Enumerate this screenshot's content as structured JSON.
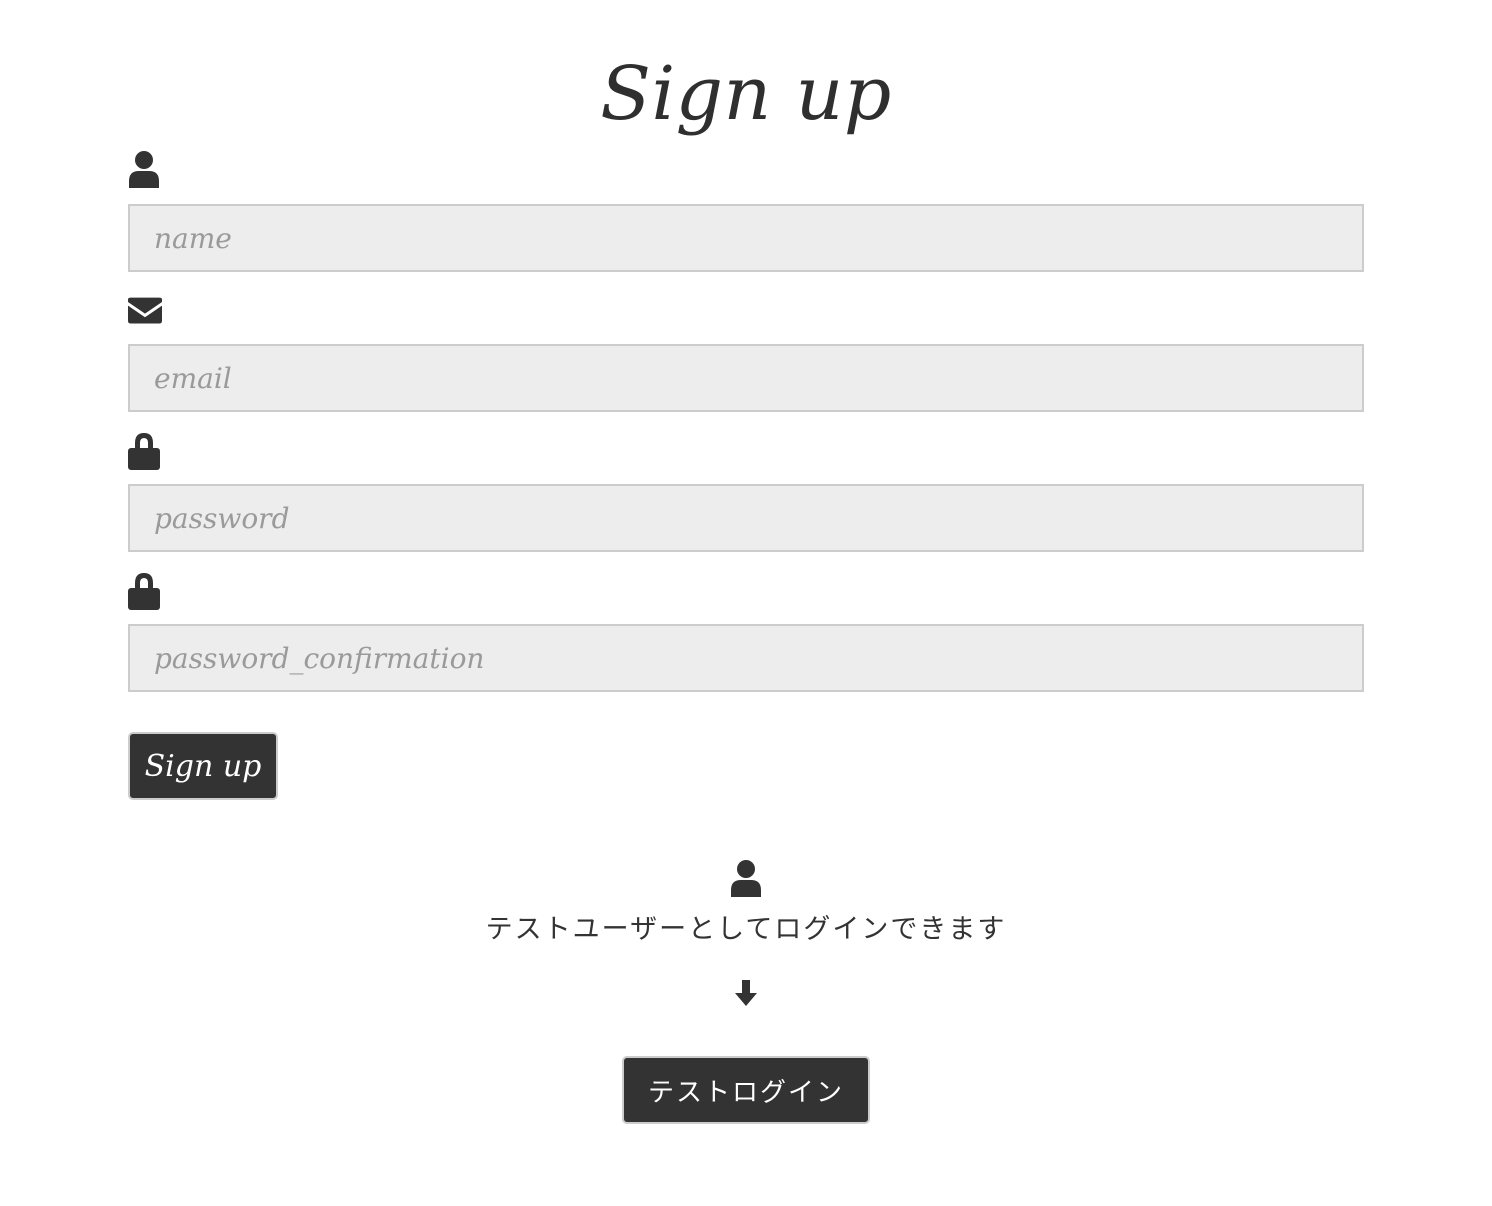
{
  "page": {
    "title": "Sign up"
  },
  "form": {
    "fields": [
      {
        "name": "name",
        "icon": "user-icon",
        "placeholder": "name",
        "value": ""
      },
      {
        "name": "email",
        "icon": "envelope-icon",
        "placeholder": "email",
        "value": ""
      },
      {
        "name": "password",
        "icon": "lock-icon",
        "placeholder": "password",
        "value": ""
      },
      {
        "name": "password_confirmation",
        "icon": "lock-icon",
        "placeholder": "password_confirmation",
        "value": ""
      }
    ],
    "submit_label": "Sign up"
  },
  "test_login": {
    "icon": "user-icon",
    "message": "テストユーザーとしてログインできます",
    "arrow_icon": "arrow-down-icon",
    "button_label": "テストログイン"
  },
  "colors": {
    "text": "#333333",
    "input_background": "#ededed",
    "input_border": "#cccccc",
    "button_background": "#333333",
    "button_text": "#ffffff",
    "placeholder": "#9a9a9a"
  }
}
